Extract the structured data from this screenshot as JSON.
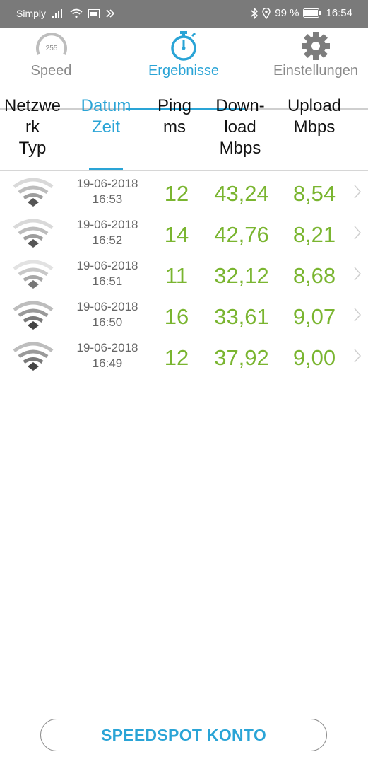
{
  "status_bar": {
    "carrier": "Simply",
    "battery_text": "99 %",
    "time": "16:54"
  },
  "tabs": [
    {
      "label": "Speed",
      "icon": "speedometer-icon",
      "gauge_text": "255",
      "active": false
    },
    {
      "label": "Ergebnisse",
      "icon": "stopwatch-icon",
      "active": true
    },
    {
      "label": "Einstellungen",
      "icon": "gear-icon",
      "active": false
    }
  ],
  "columns": {
    "network": [
      "Netzwe",
      "rk",
      "Typ"
    ],
    "datetime": [
      "Datum",
      "Zeit"
    ],
    "ping": [
      "Ping",
      "ms"
    ],
    "download": [
      "Down-",
      "load",
      "Mbps"
    ],
    "upload": [
      "Upload",
      "Mbps"
    ]
  },
  "results": [
    {
      "date": "19-06-2018",
      "time": "16:53",
      "ping": "12",
      "download": "43,24",
      "upload": "8,54"
    },
    {
      "date": "19-06-2018",
      "time": "16:52",
      "ping": "14",
      "download": "42,76",
      "upload": "8,21"
    },
    {
      "date": "19-06-2018",
      "time": "16:51",
      "ping": "11",
      "download": "32,12",
      "upload": "8,68"
    },
    {
      "date": "19-06-2018",
      "time": "16:50",
      "ping": "16",
      "download": "33,61",
      "upload": "9,07"
    },
    {
      "date": "19-06-2018",
      "time": "16:49",
      "ping": "12",
      "download": "37,92",
      "upload": "9,00"
    }
  ],
  "account_button": "SPEEDSPOT KONTO",
  "colors": {
    "accent": "#2aa4d6",
    "value_green": "#7ab530",
    "status_bar": "#7a7a7a"
  }
}
